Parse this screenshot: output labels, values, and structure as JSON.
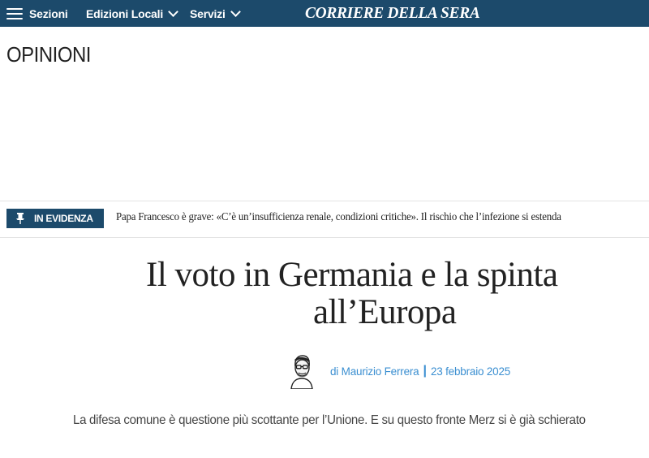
{
  "header": {
    "menu_label": "Sezioni",
    "local_label": "Edizioni Locali",
    "services_label": "Servizi",
    "logo_text": "CORRIERE DELLA SERA"
  },
  "section": {
    "title": "OPINIONI"
  },
  "evidenza": {
    "badge_label": "IN EVIDENZA",
    "text": "Papa Francesco è grave: «C’è un’insufficienza renale, condizioni critiche». Il rischio che l’infezione si estenda"
  },
  "article": {
    "headline_line1": "Il voto in Germania e la spinta",
    "headline_line2": "all’Europa",
    "author": "di Maurizio Ferrera",
    "date": "23 febbraio 2025",
    "summary": "La difesa comune è questione più scottante per l’Unione. E su questo fronte Merz si è già schierato"
  },
  "colors": {
    "brand": "#1c4a6b",
    "link": "#3b8fd1"
  }
}
